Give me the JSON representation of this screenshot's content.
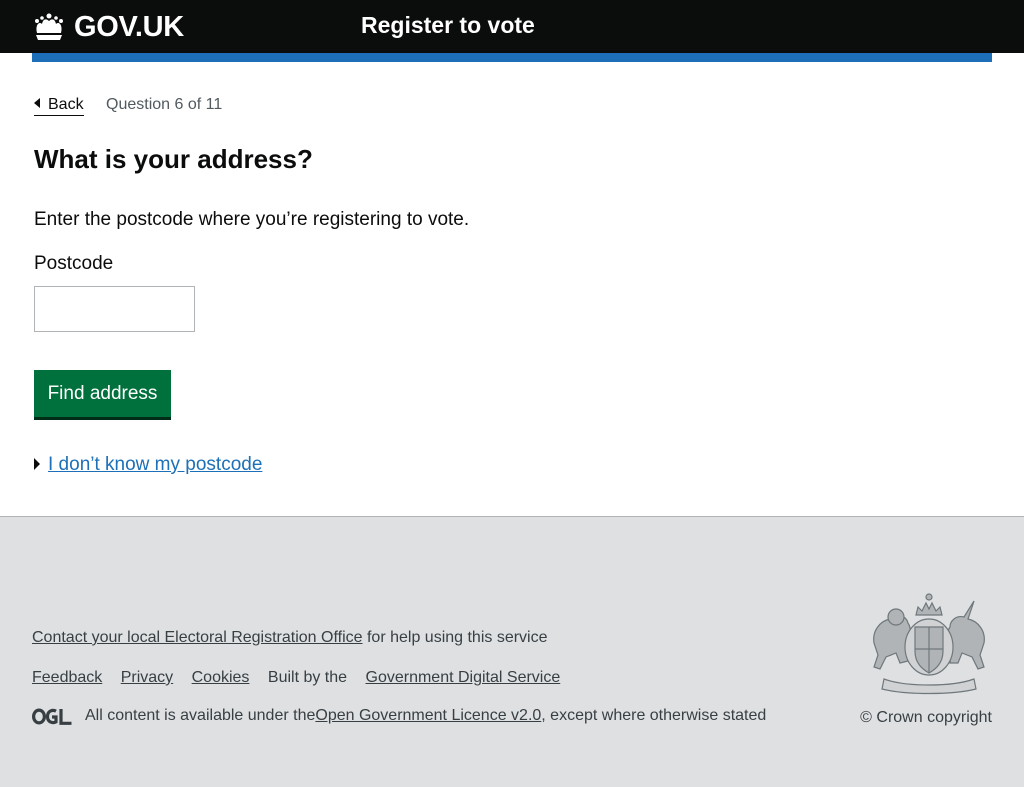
{
  "header": {
    "logo_text": "GOV.UK",
    "service_name": "Register to vote"
  },
  "nav": {
    "back_label": "Back",
    "question_count": "Question 6 of 11"
  },
  "main": {
    "title": "What is your address?",
    "hint": "Enter the postcode where you’re registering to vote.",
    "postcode_label": "Postcode",
    "postcode_value": "",
    "postcode_placeholder": "",
    "find_button_label": "Find address",
    "details_summary": "I don’t know my postcode"
  },
  "footer": {
    "help_link": "Contact your local Electoral Registration Office",
    "help_suffix": " for help using this service",
    "links": [
      "Feedback",
      "Privacy",
      "Cookies"
    ],
    "built_by_prefix": "Built by the ",
    "built_by_link": "Government Digital Service",
    "licence_prefix": "All content is available under the ",
    "licence_link": "Open Government Licence v2.0",
    "licence_suffix": ", except where otherwise stated",
    "copyright": "© Crown copyright"
  },
  "colors": {
    "header_bg": "#0b0c0c",
    "accent_blue": "#1d70b8",
    "button_green": "#00703c",
    "footer_bg": "#dee0e2"
  },
  "icons": [
    "crown-icon",
    "back-arrow-icon",
    "summary-arrow-icon",
    "ogl-icon",
    "royal-crest-icon"
  ]
}
